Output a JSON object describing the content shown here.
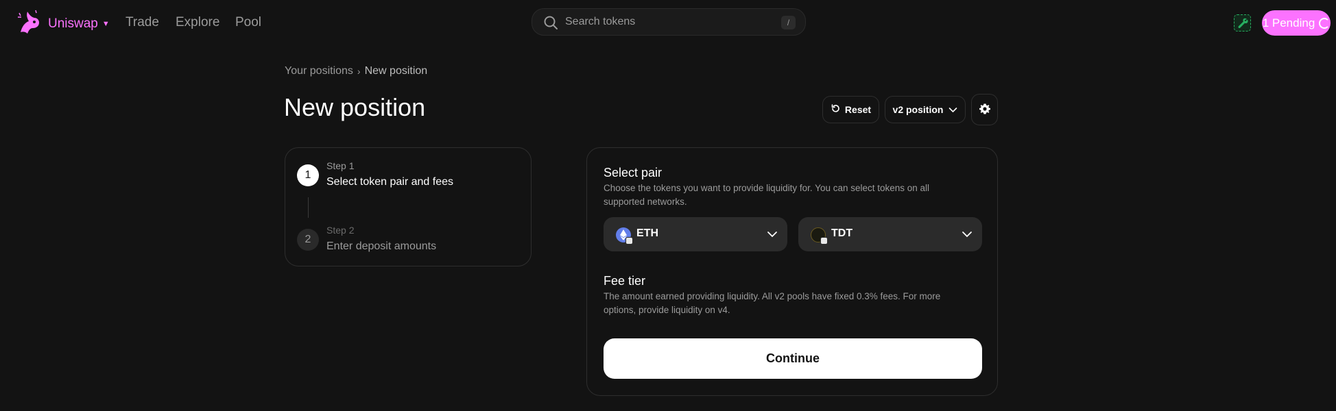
{
  "nav": {
    "brand": "Uniswap",
    "links": [
      "Trade",
      "Explore",
      "Pool"
    ],
    "search_placeholder": "Search tokens",
    "search_shortcut": "/",
    "pending_label": "1 Pending"
  },
  "breadcrumb": {
    "parent": "Your positions",
    "separator": "›",
    "current": "New position"
  },
  "page": {
    "title": "New position",
    "reset_label": "Reset",
    "version_label": "v2 position"
  },
  "steps": [
    {
      "label": "Step 1",
      "name": "Select token pair and fees",
      "number": "1"
    },
    {
      "label": "Step 2",
      "name": "Enter deposit amounts",
      "number": "2"
    }
  ],
  "pair": {
    "title": "Select pair",
    "description": "Choose the tokens you want to provide liquidity for. You can select tokens on all supported networks.",
    "token_a": "ETH",
    "token_b": "TDT"
  },
  "fee": {
    "title": "Fee tier",
    "description": "The amount earned providing liquidity. All v2 pools have fixed 0.3% fees. For more options, provide liquidity on v4."
  },
  "continue_label": "Continue",
  "colors": {
    "accent_pink": "#FC72FF",
    "background": "#131313",
    "muted_text": "#9B9B9B",
    "success_green": "#27AE60"
  }
}
